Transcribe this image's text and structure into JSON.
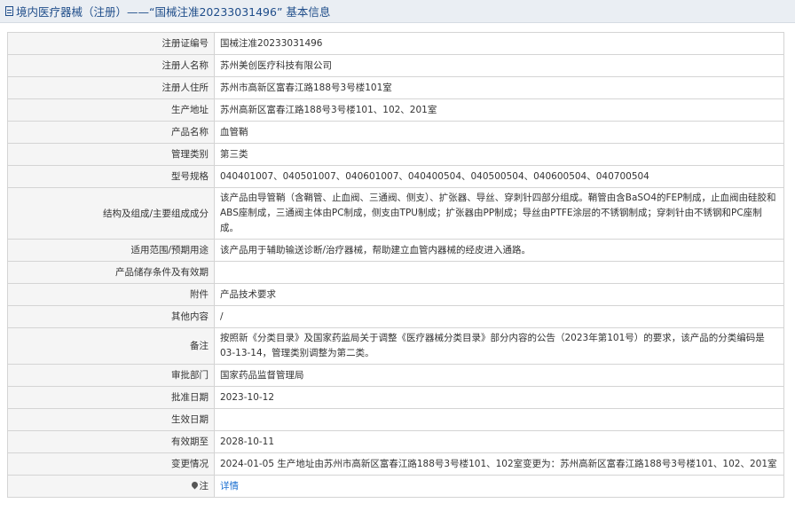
{
  "header": {
    "title": "境内医疗器械（注册）——“国械注准20233031496” 基本信息"
  },
  "rows": [
    {
      "label": "注册证编号",
      "value": "国械注准20233031496"
    },
    {
      "label": "注册人名称",
      "value": "苏州美创医疗科技有限公司"
    },
    {
      "label": "注册人住所",
      "value": "苏州市高新区富春江路188号3号楼101室"
    },
    {
      "label": "生产地址",
      "value": "苏州高新区富春江路188号3号楼101、102、201室"
    },
    {
      "label": "产品名称",
      "value": "血管鞘"
    },
    {
      "label": "管理类别",
      "value": "第三类"
    },
    {
      "label": "型号规格",
      "value": "040401007、040501007、040601007、040400504、040500504、040600504、040700504"
    },
    {
      "label": "结构及组成/主要组成成分",
      "value": "该产品由导管鞘（含鞘管、止血阀、三通阀、侧支）、扩张器、导丝、穿刺针四部分组成。鞘管由含BaSO4的FEP制成，止血阀由硅胶和ABS座制成，三通阀主体由PC制成，侧支由TPU制成；扩张器由PP制成；导丝由PTFE涂层的不锈钢制成；穿刺针由不锈钢和PC座制成。"
    },
    {
      "label": "适用范围/预期用途",
      "value": "该产品用于辅助输送诊断/治疗器械，帮助建立血管内器械的经皮进入通路。"
    },
    {
      "label": "产品储存条件及有效期",
      "value": ""
    },
    {
      "label": "附件",
      "value": "产品技术要求"
    },
    {
      "label": "其他内容",
      "value": "/"
    },
    {
      "label": "备注",
      "value": "按照新《分类目录》及国家药监局关于调整《医疗器械分类目录》部分内容的公告（2023年第101号）的要求，该产品的分类编码是03-13-14，管理类别调整为第二类。"
    },
    {
      "label": "审批部门",
      "value": "国家药品监督管理局"
    },
    {
      "label": "批准日期",
      "value": "2023-10-12"
    },
    {
      "label": "生效日期",
      "value": ""
    },
    {
      "label": "有效期至",
      "value": "2028-10-11"
    },
    {
      "label": "变更情况",
      "value": "2024-01-05 生产地址由苏州市高新区富春江路188号3号楼101、102室变更为：苏州高新区富春江路188号3号楼101、102、201室"
    }
  ],
  "note": {
    "label": "注",
    "icon": "pin-icon",
    "link_label": "详情"
  }
}
